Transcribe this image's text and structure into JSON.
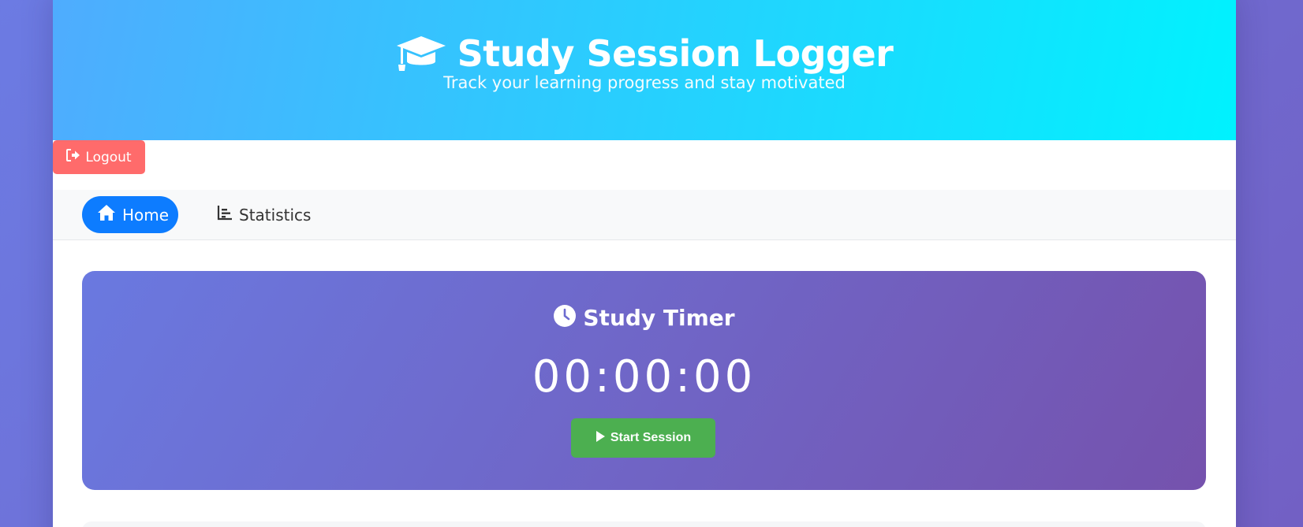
{
  "header": {
    "title": "Study Session Logger",
    "subtitle": "Track your learning progress and stay motivated",
    "icon": "graduation-cap-icon",
    "gradient": [
      "#4facfe",
      "#00f2fe"
    ]
  },
  "logout": {
    "label": "Logout",
    "icon": "sign-out-icon",
    "color": "#ff6b6b"
  },
  "nav": {
    "tabs": [
      {
        "label": "Home",
        "icon": "home-icon",
        "active": true
      },
      {
        "label": "Statistics",
        "icon": "chart-bar-icon",
        "active": false
      }
    ],
    "active_color": "#0d7cff"
  },
  "timer": {
    "title": "Study Timer",
    "icon": "clock-icon",
    "display": "00:00:00",
    "start_label": "Start Session",
    "start_icon": "play-icon",
    "start_color": "#4caf50"
  }
}
